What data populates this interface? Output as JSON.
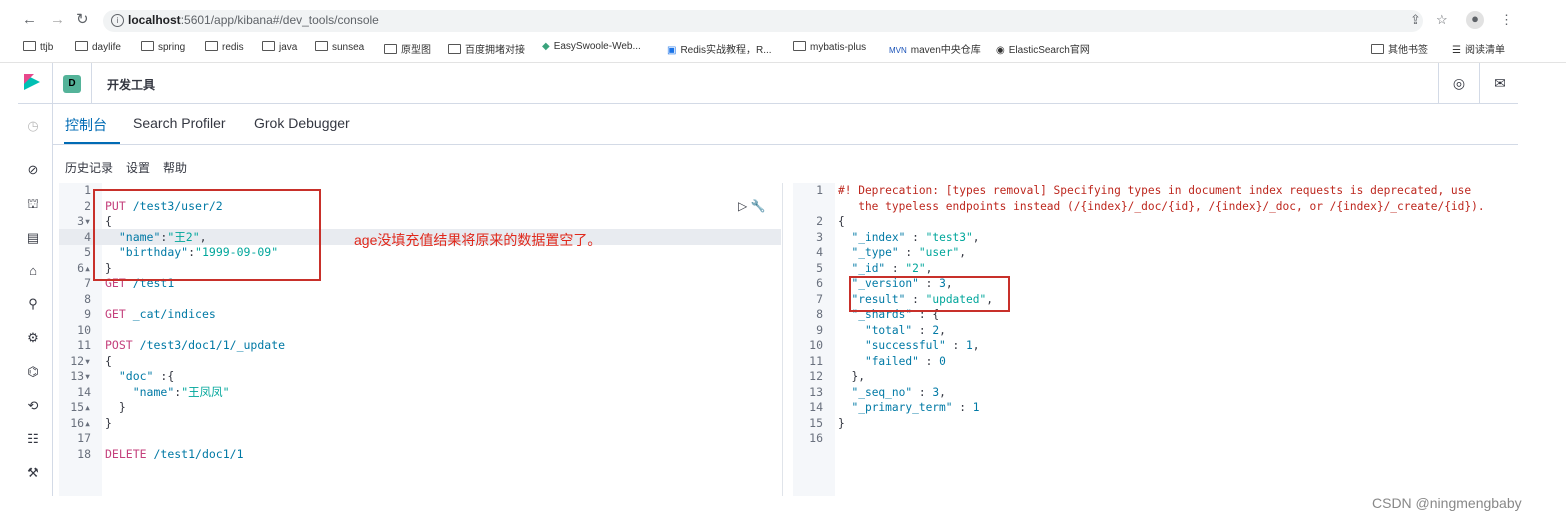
{
  "browser": {
    "url_host": "localhost",
    "url_path": ":5601/app/kibana#/dev_tools/console",
    "bookmarks": [
      "ttjb",
      "daylife",
      "spring",
      "redis",
      "java",
      "sunsea",
      "原型图",
      "百度拥堵对接",
      "EasySwoole-Web...",
      "Redis实战教程，R...",
      "mybatis-plus",
      "maven中央仓库",
      "ElasticSearch官网"
    ],
    "bookmarks_right": [
      "其他书签",
      "阅读清单"
    ]
  },
  "header": {
    "space_badge": "D",
    "title": "开发工具"
  },
  "tabs": [
    {
      "label": "控制台",
      "active": true
    },
    {
      "label": "Search Profiler",
      "active": false
    },
    {
      "label": "Grok Debugger",
      "active": false
    }
  ],
  "menu": [
    "历史记录",
    "设置",
    "帮助"
  ],
  "left_editor": {
    "line_numbers": [
      "1",
      "2",
      "3",
      "4",
      "5",
      "6",
      "7",
      "8",
      "9",
      "10",
      "11",
      "12",
      "13",
      "14",
      "15",
      "16",
      "17",
      "18"
    ],
    "fold_markers": {
      "3": "▾",
      "6": "▴",
      "12": "▾",
      "13": "▾",
      "15": "▴",
      "16": "▴"
    },
    "lines": [
      "",
      "PUT /test3/user/2",
      "{",
      "  \"name\":\"王2\",",
      "  \"birthday\":\"1999-09-09\"",
      "}",
      "GET /test1",
      "",
      "GET _cat/indices",
      "",
      "POST /test3/doc1/1/_update",
      "{",
      "  \"doc\" :{",
      "    \"name\":\"王凤凤\"",
      "  }",
      "}",
      "",
      "DELETE /test1/doc1/1"
    ]
  },
  "right_editor": {
    "line_numbers": [
      "1",
      "",
      "2",
      "3",
      "4",
      "5",
      "6",
      "7",
      "8",
      "9",
      "10",
      "11",
      "12",
      "13",
      "14",
      "15",
      "16"
    ],
    "lines": [
      "#! Deprecation: [types removal] Specifying types in document index requests is deprecated, use",
      "   the typeless endpoints instead (/{index}/_doc/{id}, /{index}/_doc, or /{index}/_create/{id}).",
      "{",
      "  \"_index\" : \"test3\",",
      "  \"_type\" : \"user\",",
      "  \"_id\" : \"2\",",
      "  \"_version\" : 3,",
      "  \"result\" : \"updated\",",
      "  \"_shards\" : {",
      "    \"total\" : 2,",
      "    \"successful\" : 1,",
      "    \"failed\" : 0",
      "  },",
      "  \"_seq_no\" : 3,",
      "  \"_primary_term\" : 1",
      "}",
      ""
    ]
  },
  "annotation": "age没填充值结果将原来的数据置空了。",
  "watermark": "CSDN @ningmengbaby"
}
